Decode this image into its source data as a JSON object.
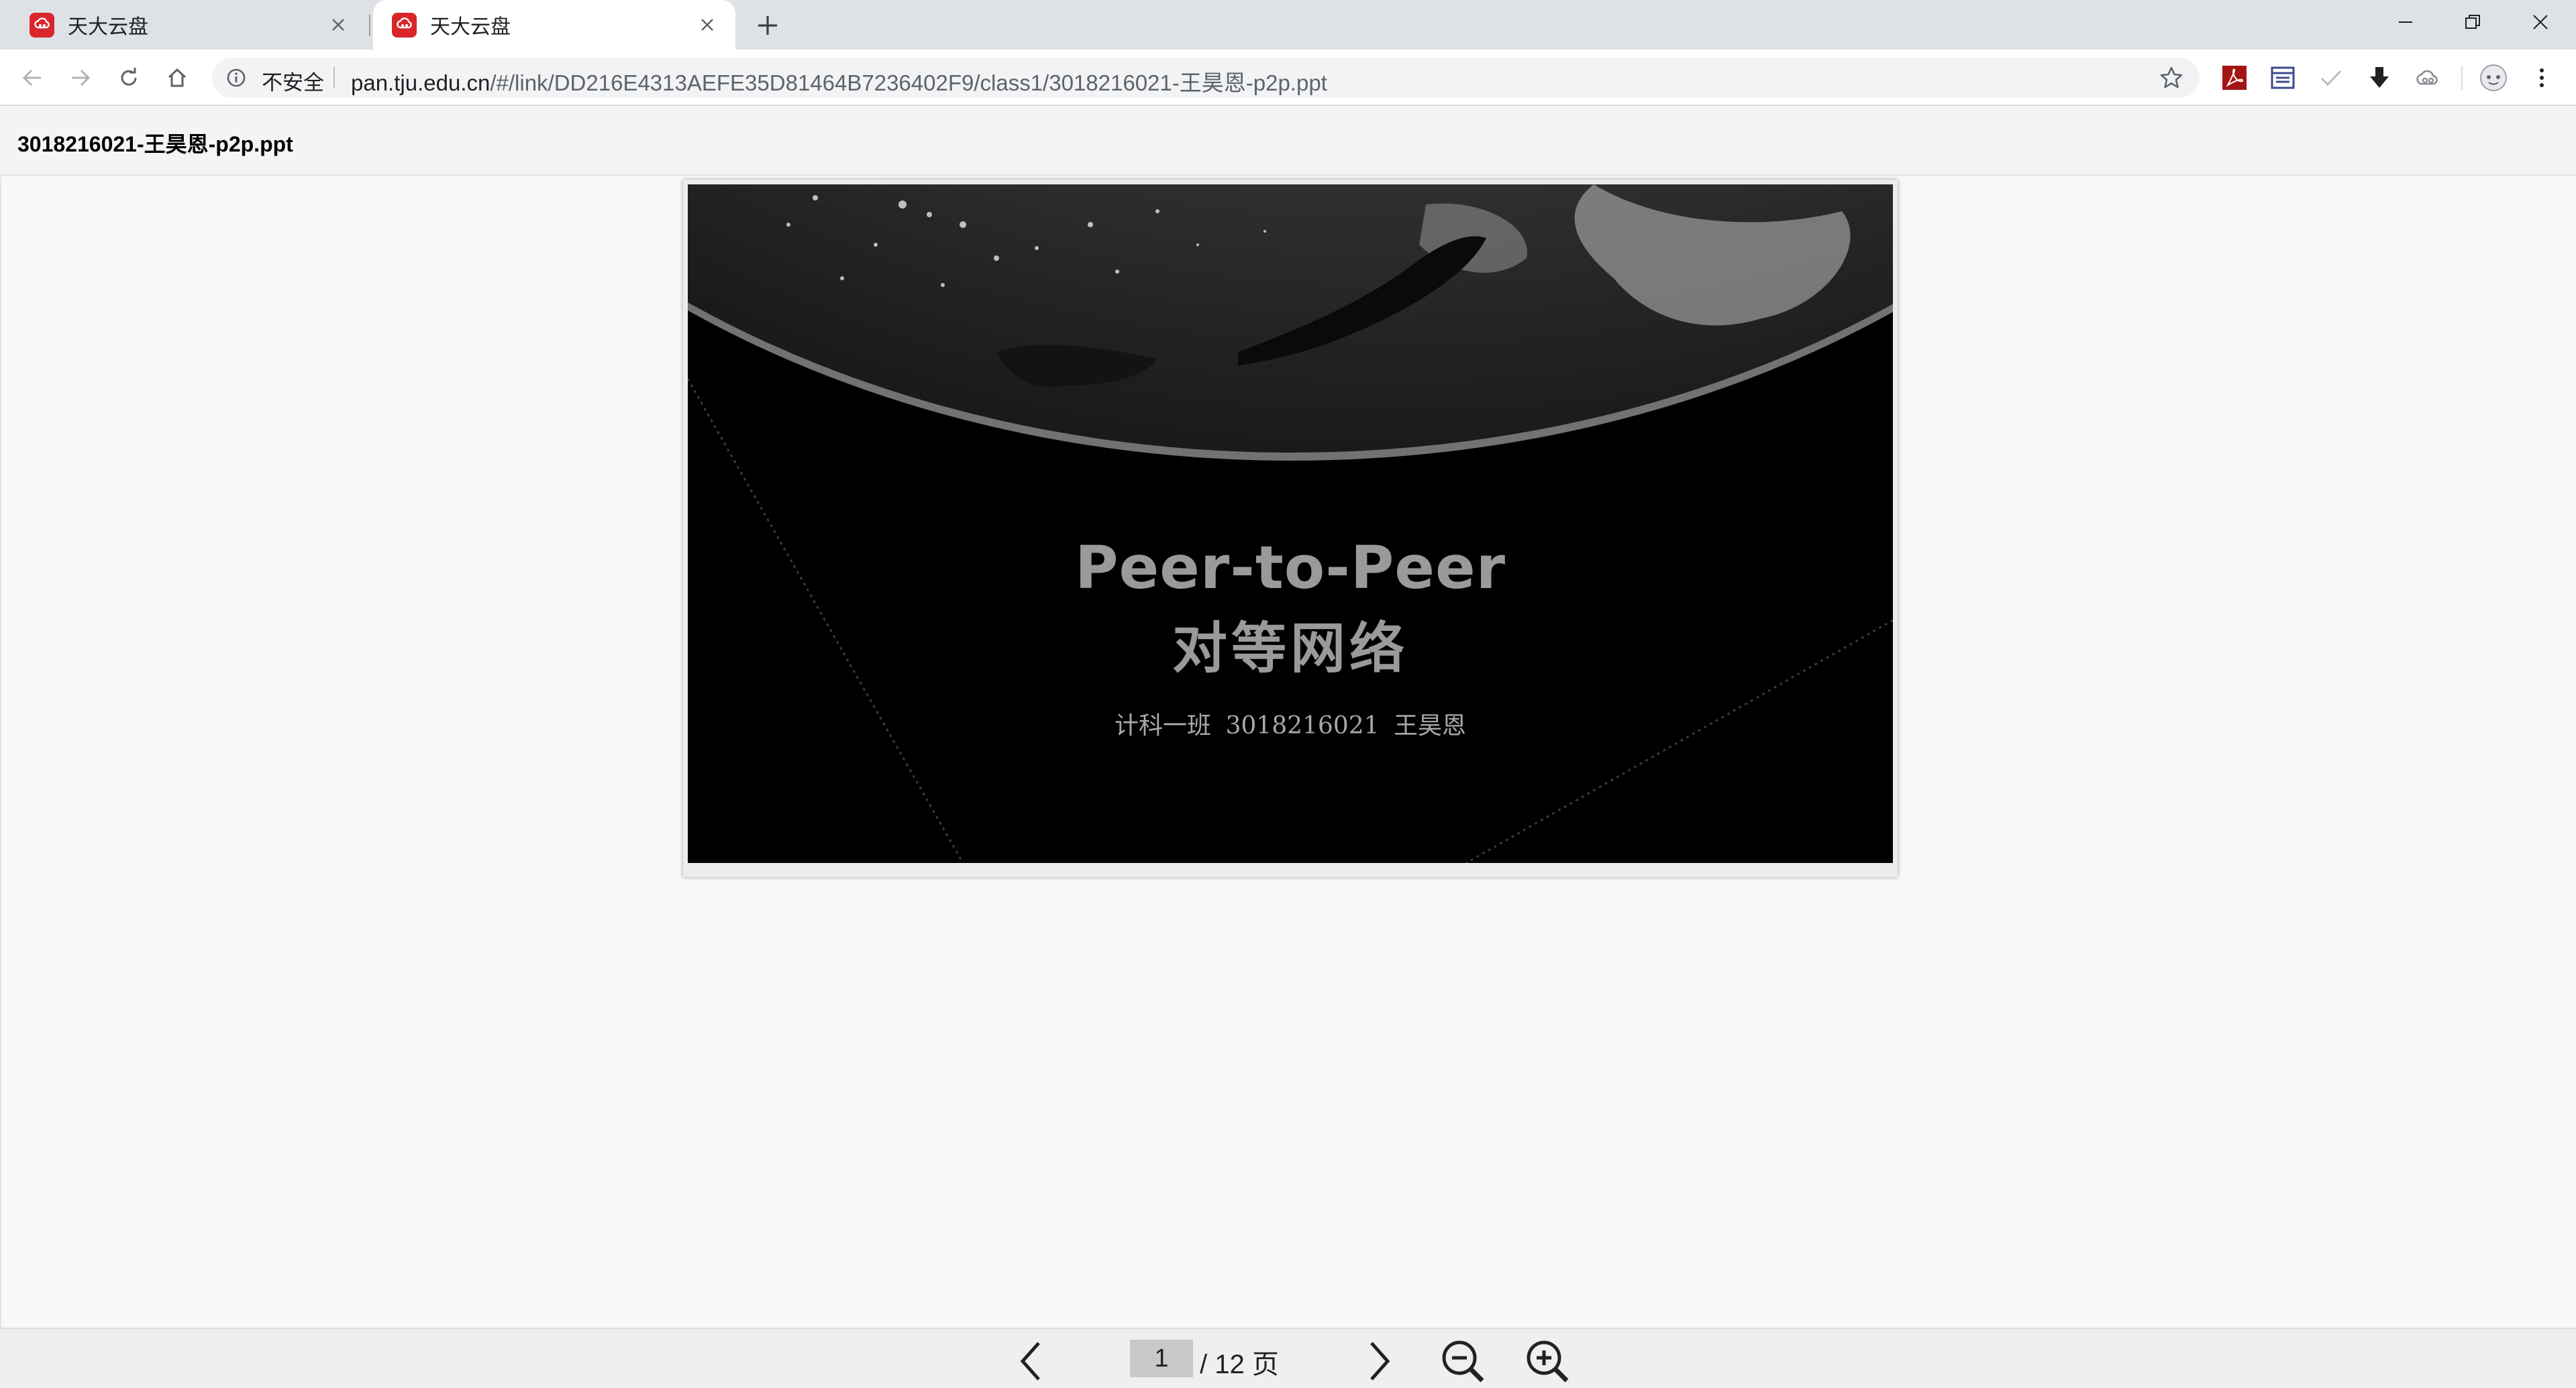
{
  "browser": {
    "tabs": [
      {
        "title": "天大云盘",
        "active": false
      },
      {
        "title": "天大云盘",
        "active": true
      }
    ],
    "omnibox": {
      "security_label": "不安全",
      "url_host": "pan.tju.edu.cn",
      "url_path": "/#/link/DD216E4313AEFE35D81464B7236402F9/class1/3018216021-王昊恩-p2p.ppt"
    },
    "extensions": [
      "acrobat-icon",
      "reader-icon",
      "checkmark-icon",
      "download-icon",
      "cloud-icon",
      "profile-avatar-icon",
      "menu-icon"
    ]
  },
  "document": {
    "filename": "3018216021-王昊恩-p2p.ppt"
  },
  "slide": {
    "title": "Peer-to-Peer",
    "subtitle": "对等网络",
    "author_line": "计科一班  3018216021  王昊恩"
  },
  "pager": {
    "current_page": "1",
    "total_text": "/ 12 页"
  },
  "colors": {
    "brand_red": "#d9262c",
    "chrome_bg": "#dee1e6",
    "page_input_bg": "#c8c8c8"
  }
}
